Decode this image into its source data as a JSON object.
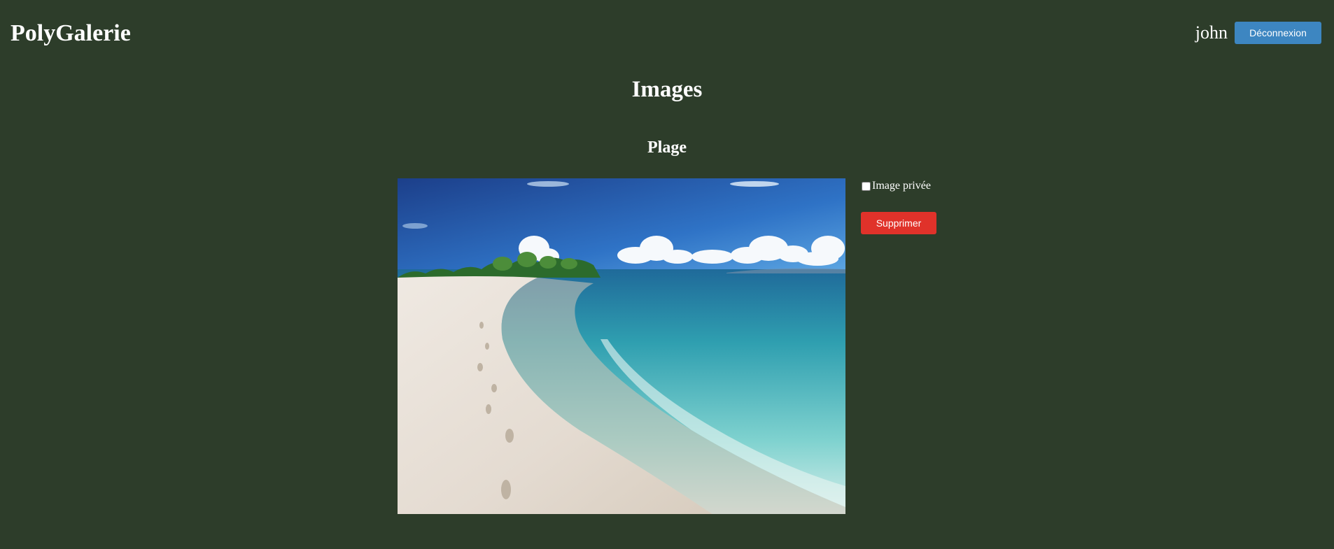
{
  "header": {
    "brand": "PolyGalerie",
    "username": "john",
    "logout_label": "Déconnexion"
  },
  "main": {
    "title": "Images",
    "images": [
      {
        "title": "Plage",
        "private_label": "Image privée",
        "private_checked": false,
        "delete_label": "Supprimer"
      }
    ]
  },
  "colors": {
    "background": "#2d3d2a",
    "logout_button": "#3d86c1",
    "delete_button": "#e0322a",
    "text": "#ffffff"
  }
}
